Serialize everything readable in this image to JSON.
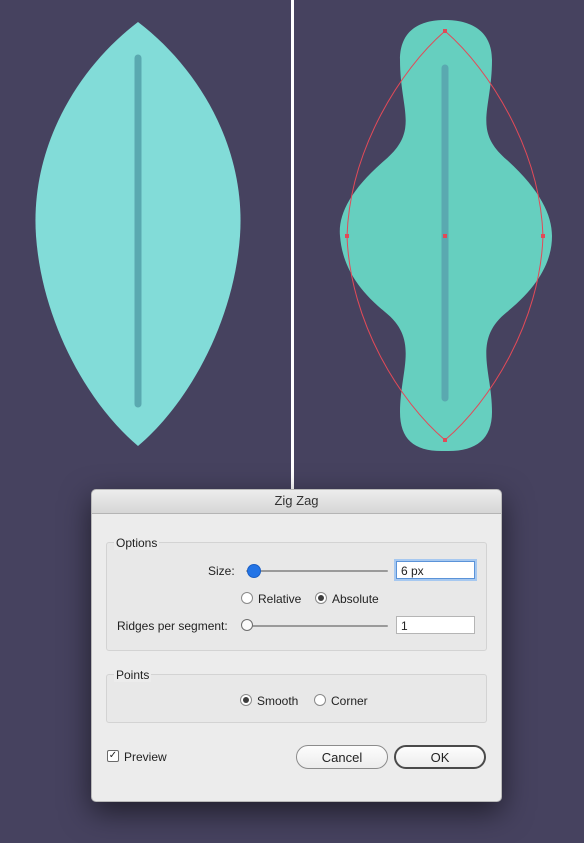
{
  "dialog": {
    "title": "Zig Zag",
    "options_group": {
      "title": "Options",
      "size_label": "Size:",
      "size_value": "6 px",
      "size_slider_fraction": 0.07,
      "relative_label": "Relative",
      "absolute_label": "Absolute",
      "selected_mode": "Absolute",
      "ridges_label": "Ridges per segment:",
      "ridges_value": "1",
      "ridges_slider_fraction": 0.0
    },
    "points_group": {
      "title": "Points",
      "smooth_label": "Smooth",
      "corner_label": "Corner",
      "selected_point": "Smooth"
    },
    "preview_label": "Preview",
    "preview_checked": true,
    "cancel_label": "Cancel",
    "ok_label": "OK"
  },
  "colors": {
    "background": "#46425f",
    "leaf_original": "#82dcd8",
    "leaf_zigzag": "#66cfbf",
    "vein": "#5aa9b0",
    "path_outline": "#e24a58",
    "slider_accent": "#2374e6"
  }
}
